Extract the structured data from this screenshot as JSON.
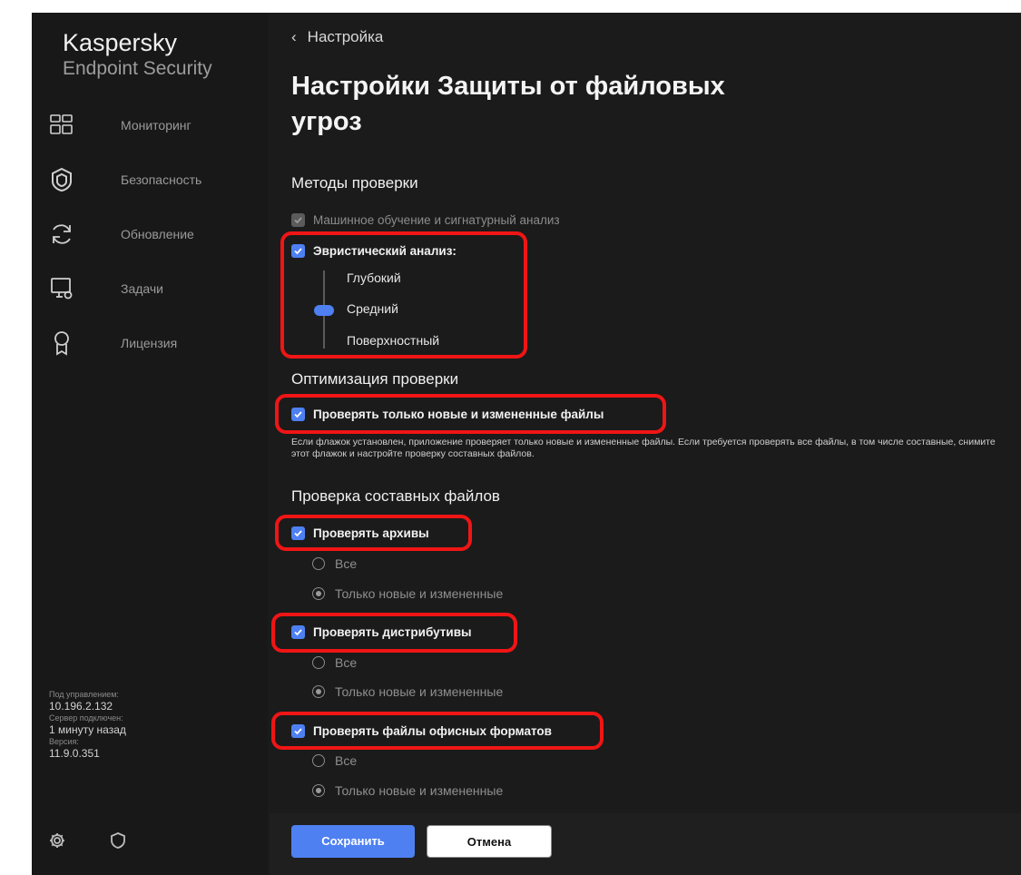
{
  "app": {
    "brand_name": "Kaspersky",
    "brand_sub": "Endpoint Security"
  },
  "sidebar": {
    "items": [
      {
        "label": "Мониторинг",
        "icon": "monitoring-icon"
      },
      {
        "label": "Безопасность",
        "icon": "shield-icon"
      },
      {
        "label": "Обновление",
        "icon": "refresh-icon"
      },
      {
        "label": "Задачи",
        "icon": "tasks-icon"
      },
      {
        "label": "Лицензия",
        "icon": "license-icon"
      }
    ],
    "meta": {
      "managed_label": "Под управлением:",
      "managed_value": "10.196.2.132",
      "server_label": "Сервер подключен:",
      "server_value": "1 минуту назад",
      "version_label": "Версия:",
      "version_value": "11.9.0.351"
    },
    "footer_icons": [
      "gear-icon",
      "kaspersky-shield-icon"
    ]
  },
  "main": {
    "back_label": "Настройка",
    "title": "Настройки Защиты от файловых угроз",
    "sections": {
      "methods": "Методы проверки",
      "optimization": "Оптимизация проверки",
      "compound": "Проверка составных файлов"
    },
    "methods": {
      "ml_label": "Машинное обучение и сигнатурный анализ",
      "heuristic_label": "Эвристический анализ:",
      "levels": [
        "Глубокий",
        "Средний",
        "Поверхностный"
      ],
      "selected_level": "Средний"
    },
    "optimization": {
      "only_new_label": "Проверять только новые и измененные файлы",
      "help": "Если флажок установлен, приложение проверяет только новые и измененные файлы. Если требуется проверять все файлы, в том числе составные, снимите этот флажок и настройте проверку составных файлов."
    },
    "compound": [
      {
        "label": "Проверять архивы",
        "options": [
          "Все",
          "Только новые и измененные"
        ],
        "selected": "Только новые и измененные"
      },
      {
        "label": "Проверять дистрибутивы",
        "options": [
          "Все",
          "Только новые и измененные"
        ],
        "selected": "Только новые и измененные"
      },
      {
        "label": "Проверять файлы офисных форматов",
        "options": [
          "Все",
          "Только новые и измененные"
        ],
        "selected": "Только новые и измененные"
      }
    ]
  },
  "buttons": {
    "save": "Сохранить",
    "cancel": "Отмена"
  },
  "colors": {
    "accent": "#4e80f2",
    "highlight": "#f01515",
    "background": "#1b1b1b"
  }
}
